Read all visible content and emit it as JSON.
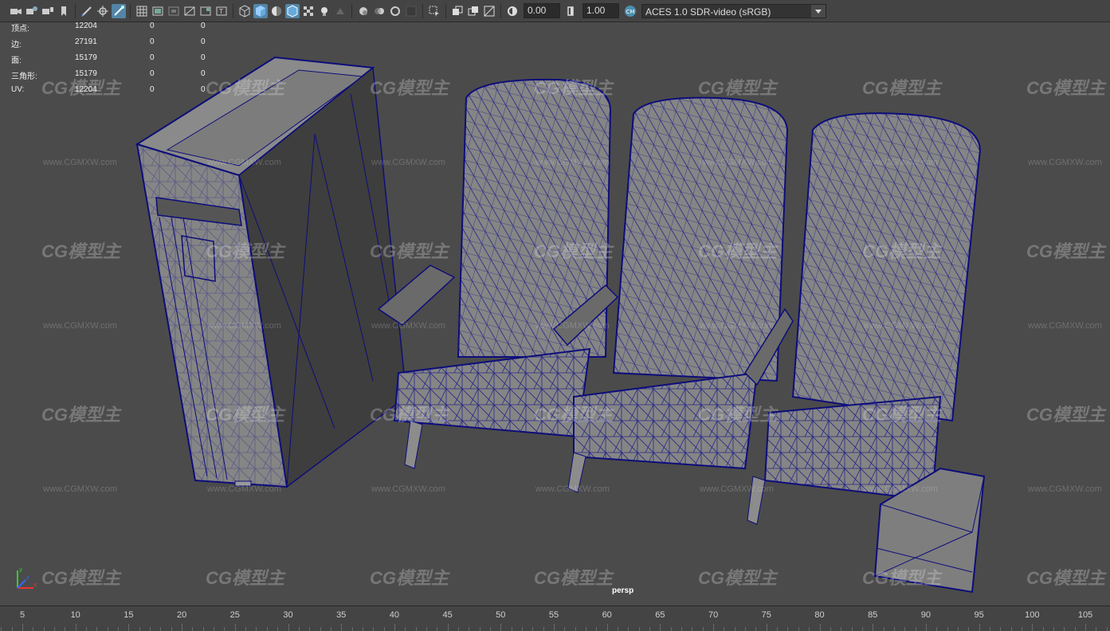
{
  "toolbar": {
    "exposure": "0.00",
    "gamma": "1.00",
    "color_management_label": "CM",
    "view_transform": "ACES 1.0 SDR-video (sRGB)"
  },
  "hud": {
    "rows": [
      {
        "label": "顶点:",
        "a": "12204",
        "b": "0",
        "c": "0"
      },
      {
        "label": "边:",
        "a": "27191",
        "b": "0",
        "c": "0"
      },
      {
        "label": "面:",
        "a": "15179",
        "b": "0",
        "c": "0"
      },
      {
        "label": "三角形:",
        "a": "15179",
        "b": "0",
        "c": "0"
      },
      {
        "label": "UV:",
        "a": "12204",
        "b": "0",
        "c": "0"
      }
    ]
  },
  "watermark": {
    "text": "CG模型主",
    "url": "www.CGMXW.com"
  },
  "viewport": {
    "camera_label": "persp",
    "axis_labels": {
      "x": "x",
      "y": "y",
      "z": "z"
    }
  },
  "timeline": {
    "ticks": [
      "5",
      "10",
      "15",
      "20",
      "25",
      "30",
      "35",
      "40",
      "45",
      "50",
      "55",
      "60",
      "65",
      "70",
      "75",
      "80",
      "85",
      "90",
      "95",
      "100",
      "105"
    ]
  },
  "colors": {
    "wire": "#0d0d7a",
    "surface": "#858585",
    "viewport_bg": "#4b4b4b",
    "accent": "#5285a6"
  }
}
